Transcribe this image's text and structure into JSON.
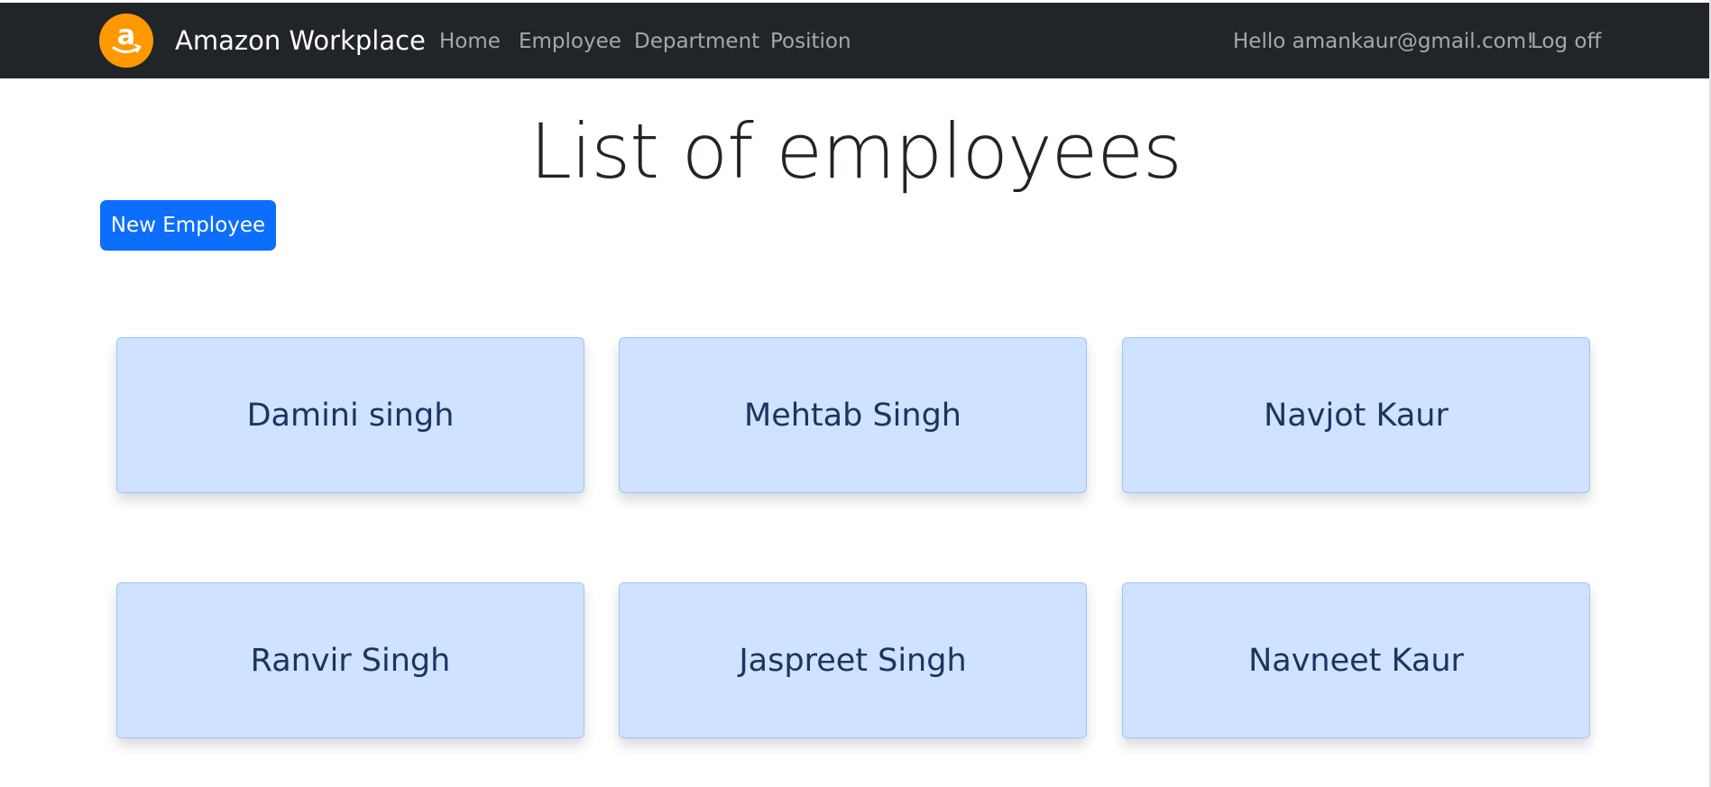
{
  "navbar": {
    "brand": "Amazon Workplace",
    "links": [
      {
        "label": "Home"
      },
      {
        "label": "Employee"
      },
      {
        "label": "Department"
      },
      {
        "label": "Position"
      }
    ],
    "greeting": "Hello amankaur@gmail.com!",
    "logoff": "Log off",
    "logo_icon": "amazon-logo-icon",
    "logo_color": "#ff9900",
    "background": "#212529"
  },
  "main": {
    "title": "List of employees",
    "new_button": "New Employee",
    "employees": [
      {
        "name": "Damini singh"
      },
      {
        "name": "Mehtab Singh"
      },
      {
        "name": "Navjot Kaur"
      },
      {
        "name": "Ranvir Singh"
      },
      {
        "name": "Jaspreet Singh"
      },
      {
        "name": "Navneet Kaur"
      }
    ]
  },
  "colors": {
    "primary": "#0d6efd",
    "card_bg": "#cfe2ff",
    "card_border": "#9ec5fe"
  }
}
